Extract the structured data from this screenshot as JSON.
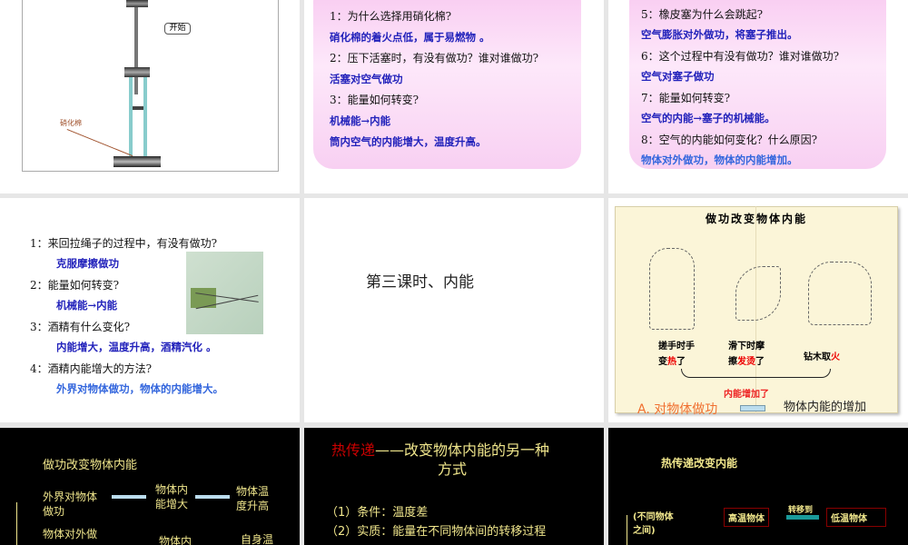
{
  "slides": [
    {
      "button": "开始",
      "label": "硝化棉"
    },
    {
      "lines": [
        "1：为什么选择用硝化棉?",
        "硝化棉的着火点低，属于易燃物 。",
        "2：压下活塞时，有没有做功？谁对谁做功?",
        "活塞对空气做功",
        "3：能量如何转变?",
        "机械能→内能",
        "筒内空气的内能增大，温度升高。"
      ]
    },
    {
      "lines": [
        "5：橡皮塞为什么会跳起?",
        "空气膨胀对外做功，将塞子推出。",
        "6：这个过程中有没有做功？谁对谁做功?",
        "空气对塞子做功",
        "7：能量如何转变?",
        "空气的内能→塞子的机械能。",
        "8：空气的内能如何变化？什么原因?",
        "物体对外做功，物体的内能增加。"
      ]
    },
    {
      "lines": [
        "1：来回拉绳子的过程中，有没有做功?",
        "克服摩擦做功",
        "2：能量如何转变?",
        "机械能→内能",
        "3：酒精有什么变化?",
        "内能增大，温度升高，酒精汽化 。",
        "4：酒精内能增大的方法?",
        "外界对物体做功，物体的内能增大。"
      ]
    },
    {
      "title": "第三课时、内能"
    },
    {
      "title": "做功改变物体内能",
      "cap1a": "搓手时手",
      "cap1b": "变",
      "cap1c": "热",
      "cap1d": "了",
      "cap2a": "滑下时摩",
      "cap2b": "擦",
      "cap2c": "发烫",
      "cap2d": "了",
      "cap3a": "钻木取",
      "cap3b": "火",
      "increase": "内能增加了",
      "left": "A. 对物体做功",
      "right": "物体内能的增加"
    },
    {
      "title": "做功改变物体内能",
      "start": "外界对物体做功",
      "mid": "物体内能增大",
      "end": "物体温度升高",
      "row2a": "物体对外做",
      "row2b": "物体内",
      "row2c": "自身温"
    },
    {
      "title_red": "热传递",
      "title_rest": "——改变物体内能的另一种",
      "title_line2": "方式",
      "p1": "（1）条件：温度差",
      "p2": "（2）实质：能量在不同物体间的转移过程"
    },
    {
      "title": "热传递改变内能",
      "cond": "(不同物体之间)",
      "hot": "高温物体",
      "transfer": "转移到",
      "cold": "低温物体"
    }
  ]
}
